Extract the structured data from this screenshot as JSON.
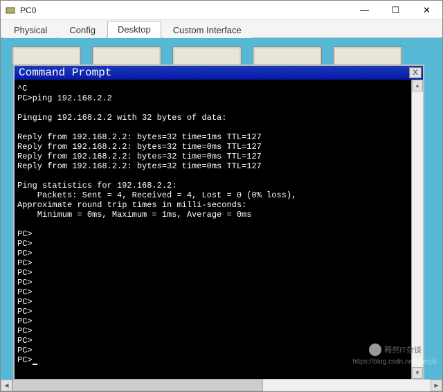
{
  "window": {
    "title": "PC0",
    "controls": {
      "min": "—",
      "max": "☐",
      "close": "✕"
    }
  },
  "tabs": [
    {
      "label": "Physical",
      "active": false
    },
    {
      "label": "Config",
      "active": false
    },
    {
      "label": "Desktop",
      "active": true
    },
    {
      "label": "Custom Interface",
      "active": false
    }
  ],
  "cmd": {
    "title": "Command Prompt",
    "close_label": "X",
    "scroll": {
      "up": "▲",
      "down": "▼",
      "left": "◀",
      "right": "▶"
    },
    "lines": [
      "^C",
      "PC>ping 192.168.2.2",
      "",
      "Pinging 192.168.2.2 with 32 bytes of data:",
      "",
      "Reply from 192.168.2.2: bytes=32 time=1ms TTL=127",
      "Reply from 192.168.2.2: bytes=32 time=0ms TTL=127",
      "Reply from 192.168.2.2: bytes=32 time=0ms TTL=127",
      "Reply from 192.168.2.2: bytes=32 time=0ms TTL=127",
      "",
      "Ping statistics for 192.168.2.2:",
      "    Packets: Sent = 4, Received = 4, Lost = 0 (0% loss),",
      "Approximate round trip times in milli-seconds:",
      "    Minimum = 0ms, Maximum = 1ms, Average = 0ms",
      "",
      "PC>",
      "PC>",
      "PC>",
      "PC>",
      "PC>",
      "PC>",
      "PC>",
      "PC>",
      "PC>",
      "PC>",
      "PC>",
      "PC>",
      "PC>"
    ],
    "prompt_final": "PC>"
  },
  "watermark": {
    "text1": "https://blog.csdn.net/gongiit",
    "text2": "释然IT杂谈"
  }
}
